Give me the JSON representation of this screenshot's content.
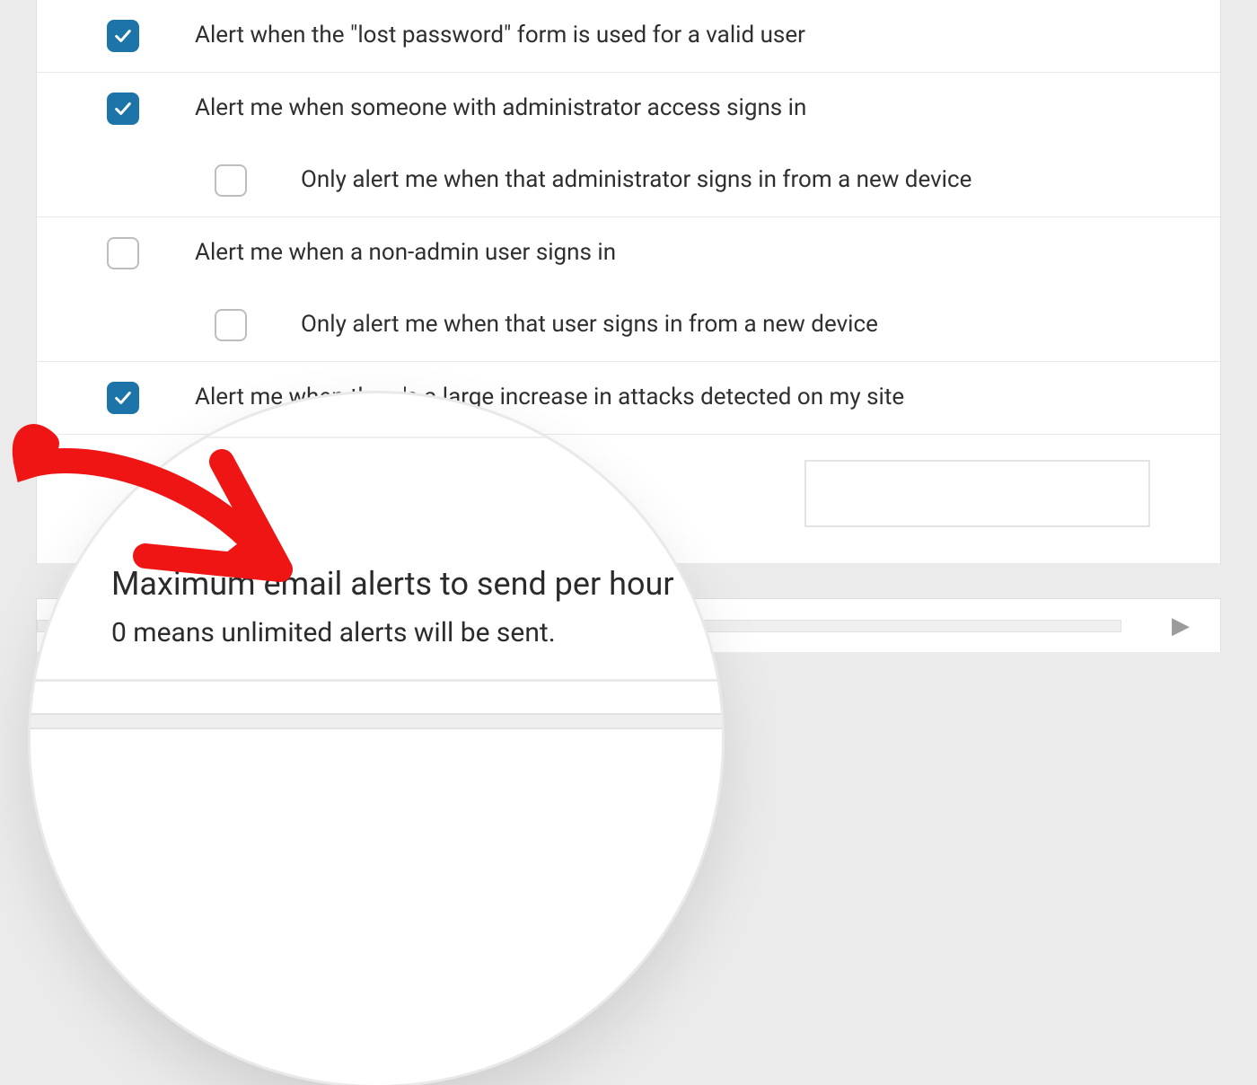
{
  "options": {
    "alert_lost_password": {
      "checked": true,
      "label": "Alert when the \"lost password\" form is used for a valid user"
    },
    "alert_admin_signin": {
      "checked": true,
      "label": "Alert me when someone with administrator access signs in"
    },
    "alert_admin_new_device": {
      "checked": false,
      "label": "Only alert me when that administrator signs in from a new device"
    },
    "alert_nonadmin_signin": {
      "checked": false,
      "label": "Alert me when a non-admin user signs in"
    },
    "alert_nonadmin_new_device": {
      "checked": false,
      "label": "Only alert me when that user signs in from a new device"
    },
    "alert_attacks": {
      "checked": true,
      "label": "Alert me when there's a large increase in attacks detected on my site"
    }
  },
  "max_alerts": {
    "title": "Maximum email alerts to send per hour",
    "subtitle": "0 means unlimited alerts will be sent.",
    "value": ""
  }
}
